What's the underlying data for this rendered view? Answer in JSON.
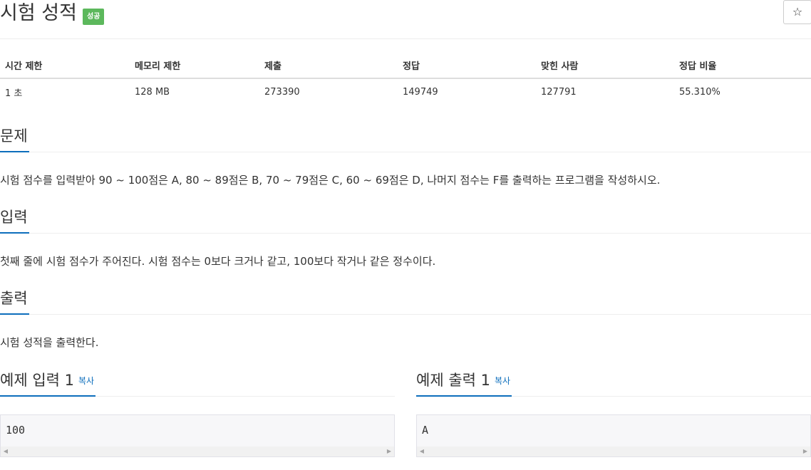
{
  "header": {
    "title": "시험 성적",
    "badge": "성공",
    "star_icon": "☆"
  },
  "info_table": {
    "headers": [
      "시간 제한",
      "메모리 제한",
      "제출",
      "정답",
      "맞힌 사람",
      "정답 비율"
    ],
    "values": [
      "1 초",
      "128 MB",
      "273390",
      "149749",
      "127791",
      "55.310%"
    ]
  },
  "problem": {
    "heading": "문제",
    "text": "시험 점수를 입력받아 90 ~ 100점은 A, 80 ~ 89점은 B, 70 ~ 79점은 C, 60 ~ 69점은 D, 나머지 점수는 F를 출력하는 프로그램을 작성하시오."
  },
  "input": {
    "heading": "입력",
    "text": "첫째 줄에 시험 점수가 주어진다. 시험 점수는 0보다 크거나 같고, 100보다 작거나 같은 정수이다."
  },
  "output": {
    "heading": "출력",
    "text": "시험 성적을 출력한다."
  },
  "sample_input": {
    "heading": "예제 입력 1",
    "copy_label": "복사",
    "content": "100"
  },
  "sample_output": {
    "heading": "예제 출력 1",
    "copy_label": "복사",
    "content": "A"
  },
  "colors": {
    "success_badge": "#5cb85c",
    "accent": "#0d6ebc",
    "text": "#333333"
  }
}
